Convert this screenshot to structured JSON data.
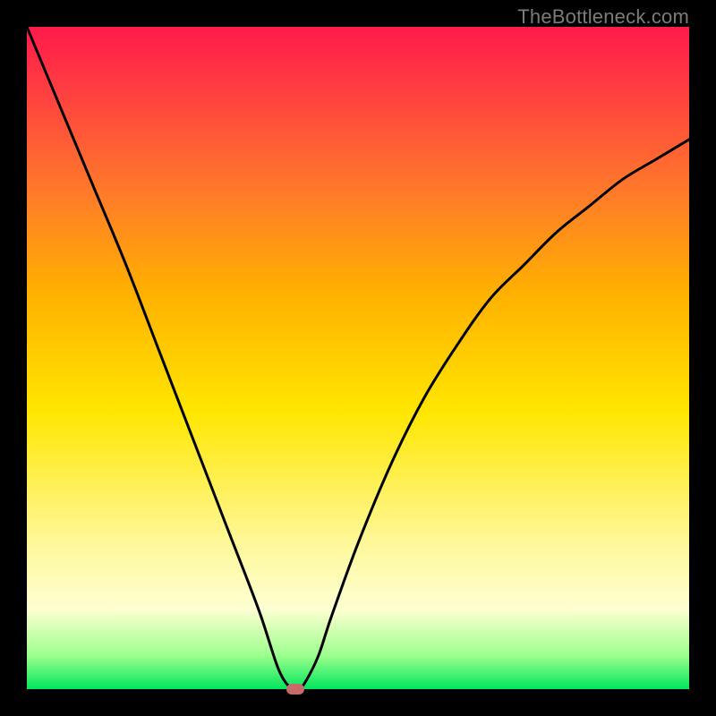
{
  "watermark": "TheBottleneck.com",
  "colors": {
    "frame": "#000000",
    "curve": "#000000",
    "marker": "#c76a6a",
    "gradient_top": "#ff1a4b",
    "gradient_bottom": "#00e65c"
  },
  "chart_data": {
    "type": "line",
    "title": "",
    "xlabel": "",
    "ylabel": "",
    "xlim": [
      0,
      100
    ],
    "ylim": [
      0,
      100
    ],
    "grid": false,
    "series": [
      {
        "name": "bottleneck-curve",
        "x": [
          0,
          5,
          10,
          15,
          20,
          25,
          30,
          35,
          38,
          40,
          41,
          42,
          44,
          46,
          50,
          55,
          60,
          65,
          70,
          75,
          80,
          85,
          90,
          95,
          100
        ],
        "values": [
          100,
          88,
          76,
          64,
          51,
          38,
          25,
          12,
          3,
          0,
          0,
          1,
          5,
          11,
          22,
          34,
          44,
          52,
          59,
          64,
          69,
          73,
          77,
          80,
          83
        ]
      }
    ],
    "marker": {
      "x": 40.5,
      "y": 0
    },
    "annotations": []
  }
}
